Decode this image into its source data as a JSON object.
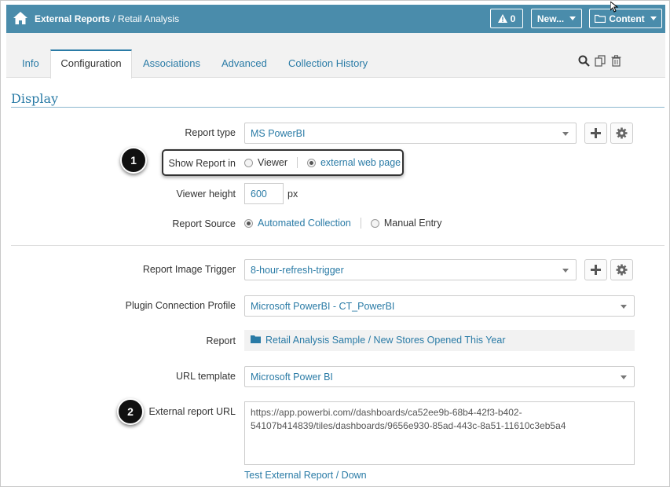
{
  "header": {
    "breadcrumb_section": "External Reports",
    "breadcrumb_sep": " / ",
    "breadcrumb_page": "Retail Analysis",
    "alert_count": "0",
    "new_label": "New...",
    "content_label": "Content",
    "bar_color": "#4a8cab"
  },
  "tabs": [
    {
      "label": "Info"
    },
    {
      "label": "Configuration",
      "active": true
    },
    {
      "label": "Associations"
    },
    {
      "label": "Advanced"
    },
    {
      "label": "Collection History"
    }
  ],
  "section": {
    "title": "Display"
  },
  "form": {
    "report_type": {
      "label": "Report type",
      "value": "MS PowerBI"
    },
    "show_report_in": {
      "label": "Show Report in",
      "option_viewer": "Viewer",
      "option_external": "external web page",
      "selected": "external web page"
    },
    "viewer_height": {
      "label": "Viewer height",
      "value": "600",
      "unit": "px"
    },
    "report_source": {
      "label": "Report Source",
      "option_automated": "Automated Collection",
      "option_manual": "Manual Entry",
      "selected": "Automated Collection"
    },
    "image_trigger": {
      "label": "Report Image Trigger",
      "value": "8-hour-refresh-trigger"
    },
    "connection_profile": {
      "label": "Plugin Connection Profile",
      "value": "Microsoft PowerBI - CT_PowerBI"
    },
    "report": {
      "label": "Report",
      "value": "Retail Analysis Sample / New Stores Opened This Year"
    },
    "url_template": {
      "label": "URL template",
      "value": "Microsoft Power BI"
    },
    "external_url": {
      "label": "External report URL",
      "line1": "https://app.powerbi.com//dashboards/ca52ee9b-68b4-42f3-b402-",
      "line2": "54107b414839/tiles/dashboards/9656e930-85ad-443c-8a51-11610c3eb5a4"
    },
    "test_link": "Test External Report / Down"
  },
  "callouts": {
    "one": "1",
    "two": "2"
  },
  "colors": {
    "accent": "#2a7ba6",
    "badge": "#111111"
  }
}
